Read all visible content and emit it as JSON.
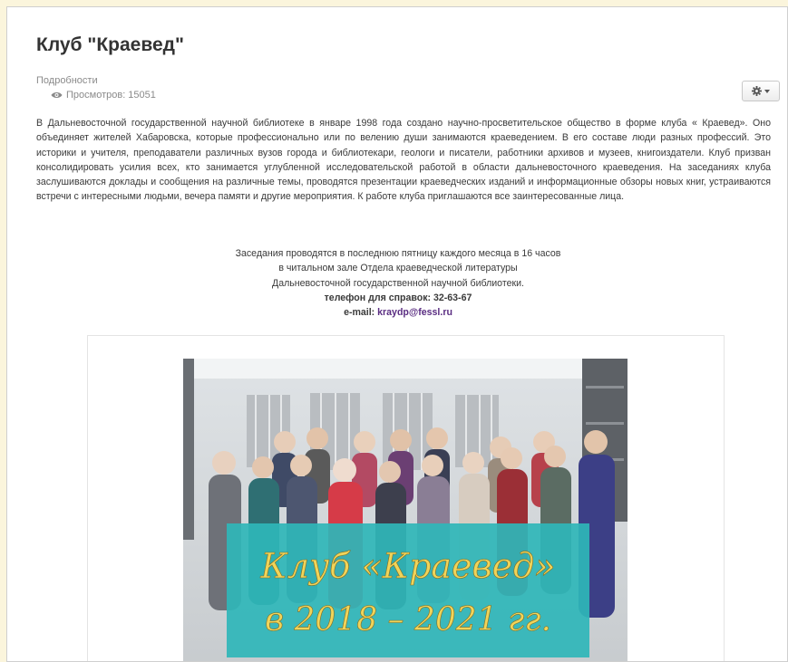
{
  "article": {
    "title": "Клуб \"Краевед\"",
    "details_label": "Подробности",
    "views_text": "Просмотров: 15051"
  },
  "toolbar": {
    "gear_icon": "gear-icon",
    "caret_icon": "caret-down-icon"
  },
  "intro_text": "В Дальневосточной государственной научной библиотеке в январе 1998 года создано научно-просветительское общество в форме клуба « Краевед». Оно объединяет жителей Хабаровска, которые профессионально или по велению души занимаются краеведением. В его составе люди разных профессий. Это историки и учителя, преподаватели различных вузов города и библиотекари, геологи и писатели, работники архивов и музеев, книгоиздатели. Клуб призван консолидировать усилия всех, кто занимается углубленной исследовательской работой в области дальневосточного краеведения. На заседаниях клуба заслушиваются доклады и сообщения на различные темы, проводятся презентации краеведческих изданий и информационные обзоры новых книг, устраиваются встречи с интересными людьми, вечера памяти и другие мероприятия. К работе клуба приглашаются все заинтересованные лица.",
  "meeting": {
    "line1": "Заседания проводятся в последнюю пятницу каждого месяца в 16 часов",
    "line2": "в читальном зале Отдела краеведческой литературы",
    "line3": "Дальневосточной государственной научной библиотеки.",
    "phone": "телефон для справок: 32-63-67",
    "email_label": "e-mail: ",
    "email": "kraydp@fessl.ru"
  },
  "banner": {
    "line1": "Клуб «Краевед»",
    "line2": "в 2018 – 2021 гг."
  },
  "colors": {
    "page_bg": "#fbf5dc",
    "link": "#5a2d82",
    "banner_bg": "#2fb6b9",
    "banner_text": "#f0d45a"
  }
}
